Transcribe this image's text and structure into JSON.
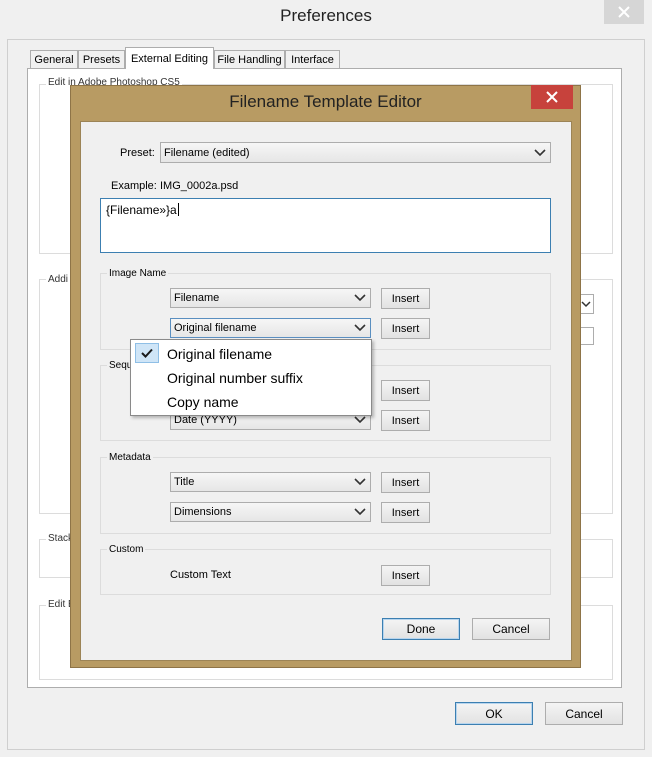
{
  "window": {
    "title": "Preferences"
  },
  "tabs": [
    "General",
    "Presets",
    "External Editing",
    "File Handling",
    "Interface"
  ],
  "background": {
    "group_labels": [
      "Edit in Adobe Photoshop CS5",
      "Addi",
      "Stack",
      "Edit E"
    ],
    "ok_label": "OK",
    "cancel_label": "Cancel"
  },
  "dialog": {
    "title": "Filename Template Editor",
    "preset_label": "Preset:",
    "preset_value": "Filename (edited)",
    "example_label": "Example:",
    "example_value": "IMG_0002a.psd",
    "token_text": "{Filename»}a",
    "image_name": {
      "label": "Image Name",
      "rows": [
        {
          "select": "Filename",
          "insert": "Insert"
        },
        {
          "select": "Original filename",
          "insert": "Insert"
        }
      ]
    },
    "sequence": {
      "label": "Sequ",
      "rows": [
        {
          "select": "",
          "insert": "Insert"
        },
        {
          "select": "Date (YYYY)",
          "insert": "Insert"
        }
      ]
    },
    "metadata": {
      "label": "Metadata",
      "rows": [
        {
          "select": "Title",
          "insert": "Insert"
        },
        {
          "select": "Dimensions",
          "insert": "Insert"
        }
      ]
    },
    "custom": {
      "label": "Custom",
      "text_label": "Custom Text",
      "insert": "Insert"
    },
    "done_label": "Done",
    "cancel_label": "Cancel"
  },
  "dropdown": {
    "items": [
      "Original filename",
      "Original number suffix",
      "Copy name"
    ],
    "selected_index": 0
  },
  "icons": {
    "close": "close-icon",
    "chevron": "chevron-down-icon",
    "check": "checkmark-icon"
  },
  "colors": {
    "dialog_frame": "#b89b63",
    "close_button": "#c7423c",
    "focus_border": "#3c7fb1"
  }
}
